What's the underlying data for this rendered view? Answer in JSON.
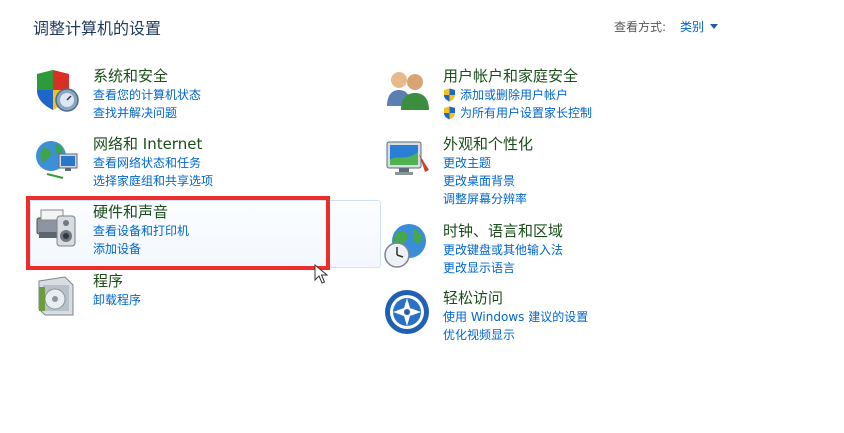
{
  "header": {
    "title": "调整计算机的设置",
    "view_by_label": "查看方式:",
    "view_by_value": "类别"
  },
  "categories": {
    "system": {
      "title": "系统和安全",
      "links": [
        "查看您的计算机状态",
        "查找并解决问题"
      ]
    },
    "network": {
      "title": "网络和 Internet",
      "links": [
        "查看网络状态和任务",
        "选择家庭组和共享选项"
      ]
    },
    "hardware": {
      "title": "硬件和声音",
      "links": [
        "查看设备和打印机",
        "添加设备"
      ]
    },
    "programs": {
      "title": "程序",
      "links": [
        "卸载程序"
      ]
    },
    "users": {
      "title": "用户帐户和家庭安全",
      "links": [
        "添加或删除用户帐户",
        "为所有用户设置家长控制"
      ]
    },
    "appearance": {
      "title": "外观和个性化",
      "links": [
        "更改主题",
        "更改桌面背景",
        "调整屏幕分辨率"
      ]
    },
    "clock": {
      "title": "时钟、语言和区域",
      "links": [
        "更改键盘或其他输入法",
        "更改显示语言"
      ]
    },
    "ease": {
      "title": "轻松访问",
      "links": [
        "使用 Windows 建议的设置",
        "优化视频显示"
      ]
    }
  },
  "colors": {
    "link": "#0066cc",
    "title": "#1a4d1a",
    "highlight": "#ee2c2c"
  }
}
